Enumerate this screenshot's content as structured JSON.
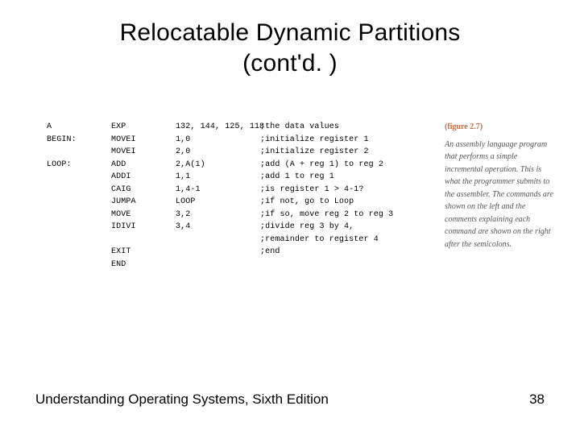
{
  "title_line1": "Relocatable Dynamic Partitions",
  "title_line2": "(cont'd. )",
  "code": {
    "rows": [
      {
        "label": "A",
        "op": "EXP",
        "args": "132, 144, 125, 118",
        "comment": ";the data values"
      },
      {
        "label": "BEGIN:",
        "op": "MOVEI",
        "args": "1,0",
        "comment": ";initialize register 1"
      },
      {
        "label": "",
        "op": "MOVEI",
        "args": "2,0",
        "comment": ";initialize register 2"
      },
      {
        "label": "LOOP:",
        "op": "ADD",
        "args": "2,A(1)",
        "comment": ";add (A + reg 1) to reg 2"
      },
      {
        "label": "",
        "op": "ADDI",
        "args": "1,1",
        "comment": ";add 1 to reg 1"
      },
      {
        "label": "",
        "op": "CAIG",
        "args": "1,4-1",
        "comment": ";is register 1 > 4-1?"
      },
      {
        "label": "",
        "op": "JUMPA",
        "args": "LOOP",
        "comment": ";if not, go to Loop"
      },
      {
        "label": "",
        "op": "MOVE",
        "args": "3,2",
        "comment": ";if so, move reg 2 to reg 3"
      },
      {
        "label": "",
        "op": "IDIVI",
        "args": "3,4",
        "comment": ";divide reg 3 by 4,"
      },
      {
        "label": "",
        "op": "",
        "args": "",
        "comment": ";remainder to register 4"
      },
      {
        "label": "",
        "op": "EXIT",
        "args": "",
        "comment": ";end"
      },
      {
        "label": "",
        "op": "END",
        "args": "",
        "comment": ""
      }
    ]
  },
  "figure": {
    "label": "(figure 2.7)",
    "caption": "An assembly language program that performs a simple incremental operation. This is what the programmer submits to the assembler. The commands are shown on the left and the comments explaining each command are shown on the right after the semicolons."
  },
  "footer": {
    "book": "Understanding Operating Systems, Sixth Edition",
    "page": "38"
  }
}
